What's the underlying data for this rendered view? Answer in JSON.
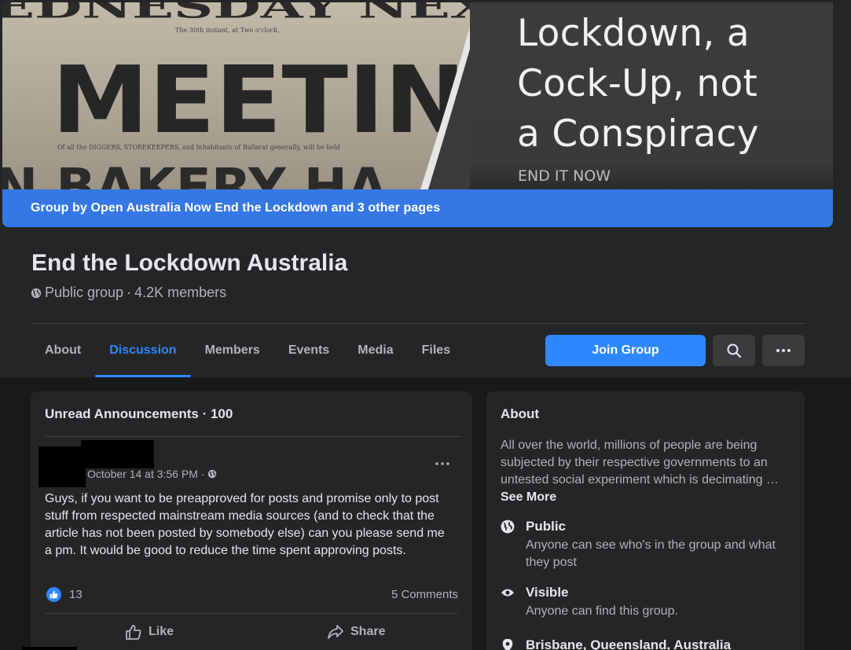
{
  "cover": {
    "image_text": [
      "EDNESDAY NEX",
      "MEETIN",
      "N BAKERY HA"
    ],
    "headline_lines": [
      "Lockdown, a",
      "Cock-Up, not",
      "a Conspiracy"
    ],
    "subline": "END IT NOW",
    "banner": "Group by Open Australia Now End the Lockdown and 3 other pages"
  },
  "group": {
    "title": "End the Lockdown Australia",
    "privacy": "Public group",
    "separator": " · ",
    "members": "4.2K members"
  },
  "tabs": [
    "About",
    "Discussion",
    "Members",
    "Events",
    "Media",
    "Files"
  ],
  "active_tab": "Discussion",
  "actions": {
    "join_label": "Join Group",
    "search_icon": "search-icon",
    "more_icon": "more-horizontal-icon"
  },
  "announcements": {
    "title": "Unread Announcements · 100",
    "post": {
      "timestamp": "October 14 at 3:56 PM · ",
      "body": "Guys, if you want to be preapproved for posts and promise only to post stuff from respected mainstream media sources (and to check that the article has not been posted by somebody else) can you please send me a pm. It would be good to reduce the time spent approving posts.",
      "like_count": "13",
      "comments": "5 Comments",
      "like_label": "Like",
      "share_label": "Share"
    }
  },
  "about": {
    "title": "About",
    "description": "All over the world, millions of people are being subjected by their respective governments to an untested social experiment which is decimating … ",
    "see_more": "See More",
    "rows": [
      {
        "icon": "globe-icon",
        "title": "Public",
        "desc": "Anyone can see who's in the group and what they post"
      },
      {
        "icon": "eye-icon",
        "title": "Visible",
        "desc": "Anyone can find this group."
      },
      {
        "icon": "location-pin-icon",
        "title": "Brisbane, Queensland, Australia",
        "desc": ""
      }
    ]
  },
  "colors": {
    "accent": "#2d88ff",
    "banner": "#3578e5",
    "background": "#18191a",
    "surface": "#242526"
  }
}
